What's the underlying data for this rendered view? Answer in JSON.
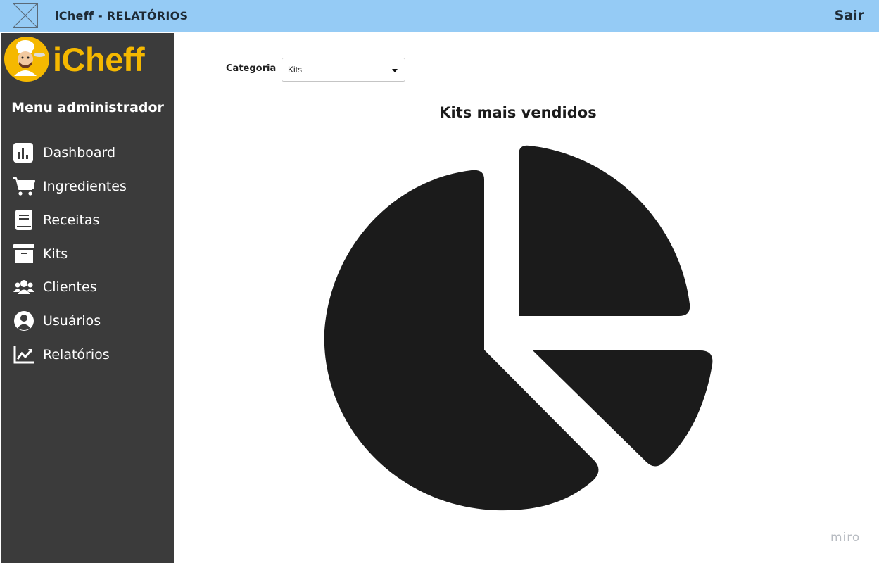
{
  "header": {
    "title": "iCheff - RELATÓRIOS",
    "logout_label": "Sair"
  },
  "sidebar": {
    "logo_text": "iCheff",
    "heading": "Menu administrador",
    "items": [
      {
        "label": "Dashboard",
        "icon": "bar-chart-icon"
      },
      {
        "label": "Ingredientes",
        "icon": "shopping-cart-icon"
      },
      {
        "label": "Receitas",
        "icon": "book-icon"
      },
      {
        "label": "Kits",
        "icon": "archive-box-icon"
      },
      {
        "label": "Clientes",
        "icon": "users-icon"
      },
      {
        "label": "Usuários",
        "icon": "user-circle-icon"
      },
      {
        "label": "Relatórios",
        "icon": "line-chart-icon"
      }
    ]
  },
  "filter": {
    "label": "Categoria",
    "selected": "Kits"
  },
  "chart": {
    "title": "Kits mais vendidos",
    "icon": "pie-chart-icon"
  },
  "watermark": "miro",
  "colors": {
    "topbar": "#95cbf5",
    "sidebar": "#3b3b3b",
    "logo": "#f5b800",
    "pie": "#1b1b1b"
  }
}
